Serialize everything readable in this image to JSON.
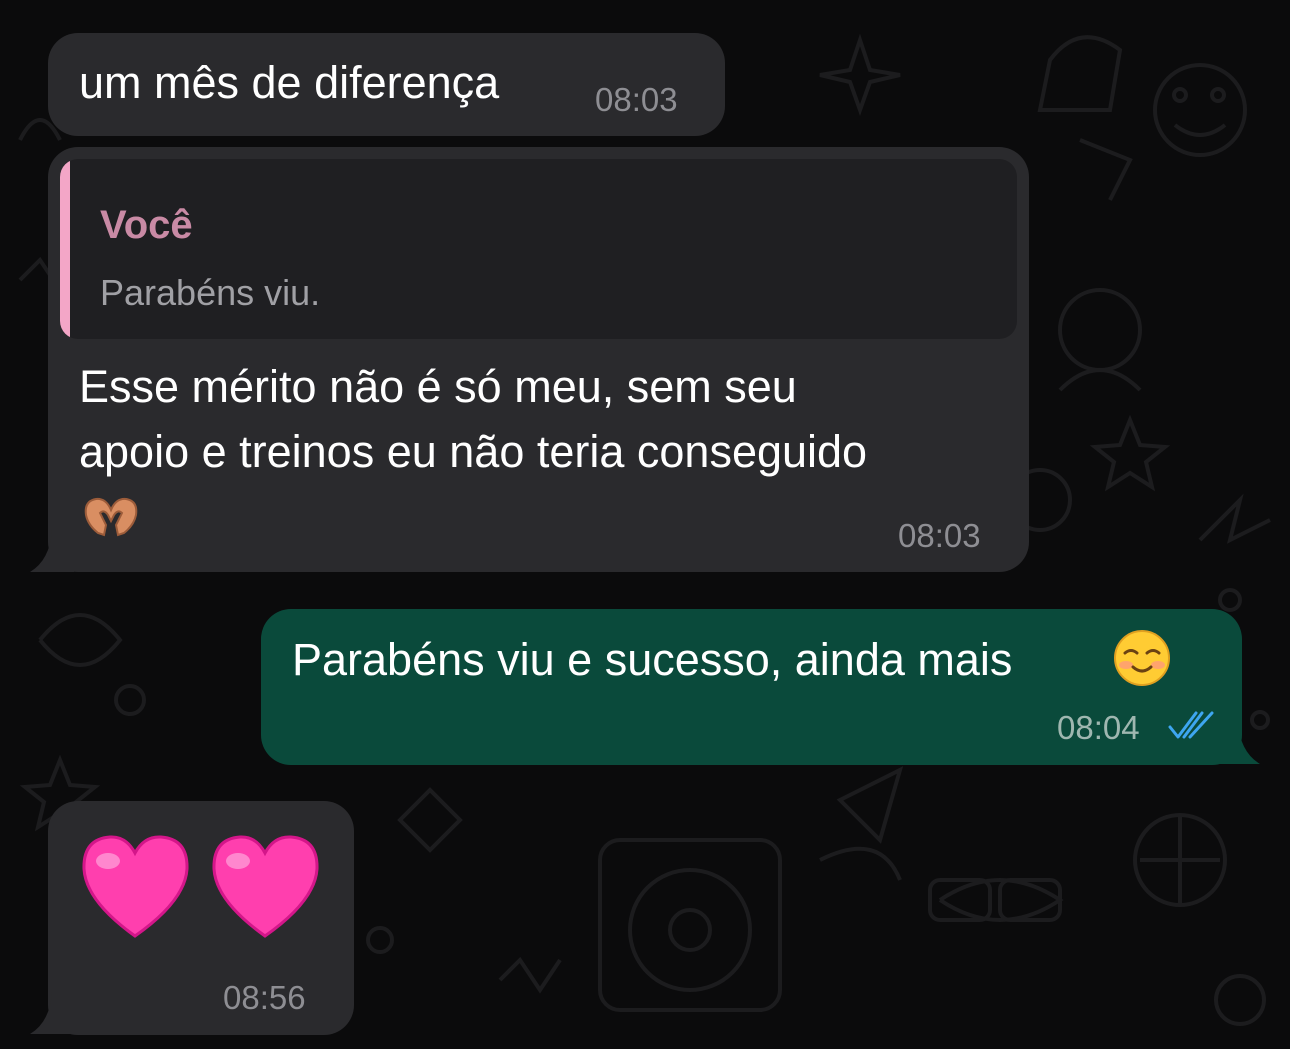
{
  "messages": [
    {
      "direction": "incoming",
      "text": "um mês de diferença",
      "time": "08:03"
    },
    {
      "direction": "incoming",
      "reply_to": {
        "author": "Você",
        "text": "Parabéns viu."
      },
      "text_line1": "Esse mérito não é só meu, sem seu",
      "text_line2": "apoio e treinos eu não teria conseguido",
      "emoji": "heart-hands",
      "time": "08:03"
    },
    {
      "direction": "outgoing",
      "text": "Parabéns viu e sucesso, ainda mais",
      "emoji": "smiling-face",
      "time": "08:04",
      "status": "read"
    },
    {
      "direction": "incoming",
      "emoji": "pink-hearts",
      "time": "08:56"
    }
  ],
  "colors": {
    "background": "#0b0b0c",
    "incoming_bubble": "#2a2a2d",
    "outgoing_bubble": "#0a4a3b",
    "quote_bar": "#f3a6c7",
    "quote_author": "#c98aa5",
    "read_ticks": "#3ea6f0",
    "heart": "#ff4fb4"
  }
}
